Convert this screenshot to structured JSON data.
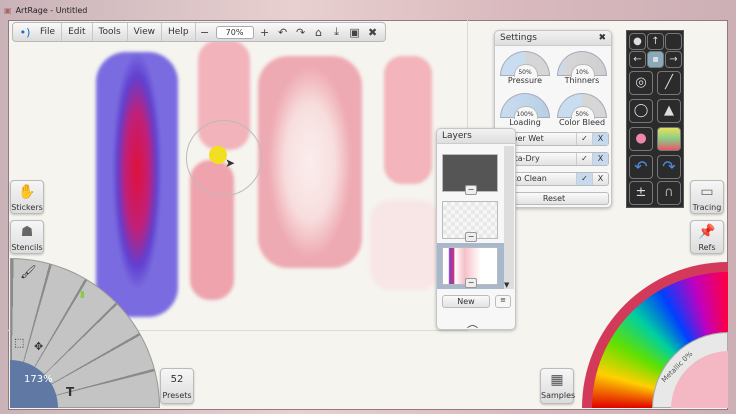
{
  "window": {
    "title": "ArtRage - Untitled"
  },
  "toolbar": {
    "menu": [
      "File",
      "Edit",
      "Tools",
      "View",
      "Help"
    ],
    "zoom": "70%",
    "zoom_out": "−",
    "zoom_in": "+"
  },
  "settings": {
    "title": "Settings",
    "dials": [
      {
        "label": "Pressure",
        "value": "50%"
      },
      {
        "label": "Thinners",
        "value": "10%"
      },
      {
        "label": "Loading",
        "value": "100%"
      },
      {
        "label": "Color Bleed",
        "value": "50%"
      }
    ],
    "toggles": [
      {
        "label": "Paper Wet",
        "state": "off"
      },
      {
        "label": "Insta-Dry",
        "state": "off"
      },
      {
        "label": "Auto Clean",
        "state": "on"
      }
    ],
    "check": "✓",
    "x": "X",
    "reset": "Reset"
  },
  "layers": {
    "title": "Layers",
    "new": "New"
  },
  "side": {
    "stickers": "Stickers",
    "stencils": "Stencils",
    "tracing": "Tracing",
    "refs": "Refs",
    "presets_count": "52",
    "presets": "Presets",
    "samples": "Samples"
  },
  "toolwheel": {
    "zoom": "173%"
  },
  "colorwheel": {
    "metallic": "Metallic 0%"
  }
}
